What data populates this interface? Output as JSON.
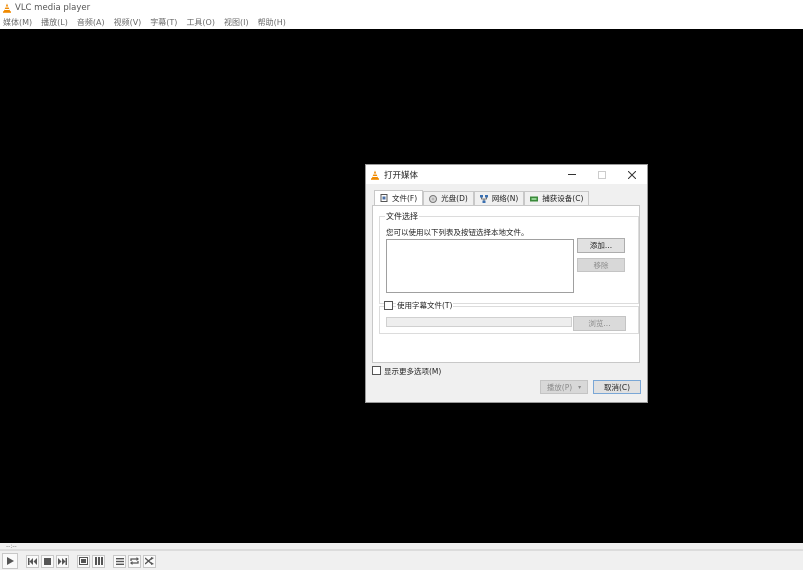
{
  "window": {
    "title": "VLC media player"
  },
  "menu": {
    "items": [
      "媒体(M)",
      "播放(L)",
      "音频(A)",
      "视频(V)",
      "字幕(T)",
      "工具(O)",
      "视图(I)",
      "帮助(H)"
    ]
  },
  "seek": {
    "time_elapsed": "--:--"
  },
  "controls": {
    "icons": [
      "play-icon",
      "previous-icon",
      "stop-icon",
      "next-icon",
      "fullscreen-icon",
      "extended-settings-icon",
      "playlist-icon",
      "loop-icon",
      "shuffle-icon"
    ]
  },
  "dialog": {
    "title": "打开媒体",
    "tabs": [
      {
        "label": "文件(F)",
        "icon": "file-icon",
        "active": true
      },
      {
        "label": "光盘(D)",
        "icon": "disc-icon",
        "active": false
      },
      {
        "label": "网络(N)",
        "icon": "network-icon",
        "active": false
      },
      {
        "label": "捕获设备(C)",
        "icon": "capture-device-icon",
        "active": false
      }
    ],
    "file_group": {
      "label": "文件选择",
      "hint": "您可以使用以下列表及按钮选择本地文件。",
      "add_button": "添加...",
      "remove_button": "移除"
    },
    "subtitle_group": {
      "checkbox_label": "使用字幕文件(T)",
      "checked": false,
      "input_value": "",
      "browse_button": "浏览..."
    },
    "more_options": {
      "label": "显示更多选项(M)",
      "checked": false
    },
    "play_button": "播放(P)",
    "cancel_button": "取消(C)"
  },
  "colors": {
    "video_background": "#000000",
    "chrome": "#f0f0f0",
    "vlc_orange": "#f08a00"
  }
}
